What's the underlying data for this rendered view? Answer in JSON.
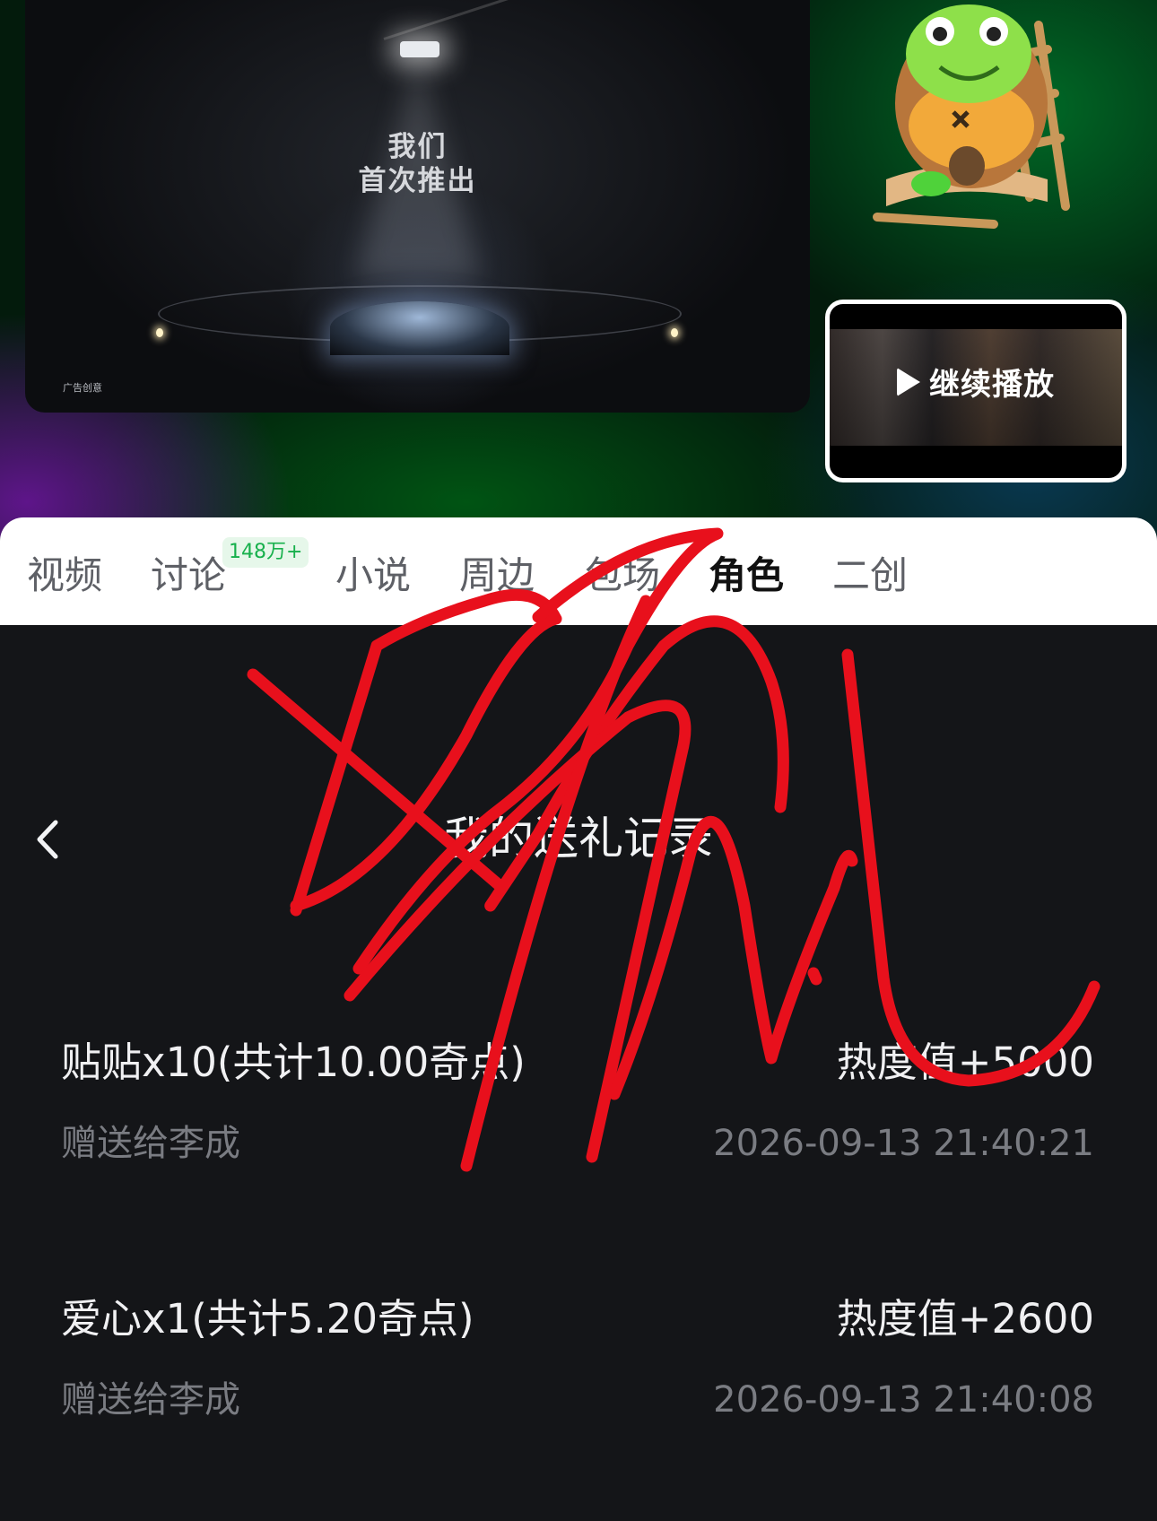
{
  "ad": {
    "headline_line1": "我们",
    "headline_line2": "首次推出",
    "label": "广告创意"
  },
  "mini_player": {
    "resume_label": "继续播放"
  },
  "tabs": [
    {
      "label": "视频"
    },
    {
      "label": "讨论",
      "badge": "148万+"
    },
    {
      "label": "小说"
    },
    {
      "label": "周边"
    },
    {
      "label": "包场"
    },
    {
      "label": "角色",
      "active": true
    },
    {
      "label": "二创"
    }
  ],
  "page": {
    "title": "我的送礼记录"
  },
  "records": [
    {
      "gift": "贴贴x10(共计10.00奇点)",
      "heat": "热度值+5000",
      "recipient": "赠送给李成",
      "time": "2026-09-13 21:40:21"
    },
    {
      "gift": "爱心x1(共计5.20奇点)",
      "heat": "热度值+2600",
      "recipient": "赠送给李成",
      "time": "2026-09-13 21:40:08"
    }
  ],
  "colors": {
    "signature": "#e8101c",
    "badge_text": "#17b04c",
    "page_bg": "#141518"
  },
  "icons": {
    "back": "chevron-left-icon",
    "play": "play-icon"
  }
}
